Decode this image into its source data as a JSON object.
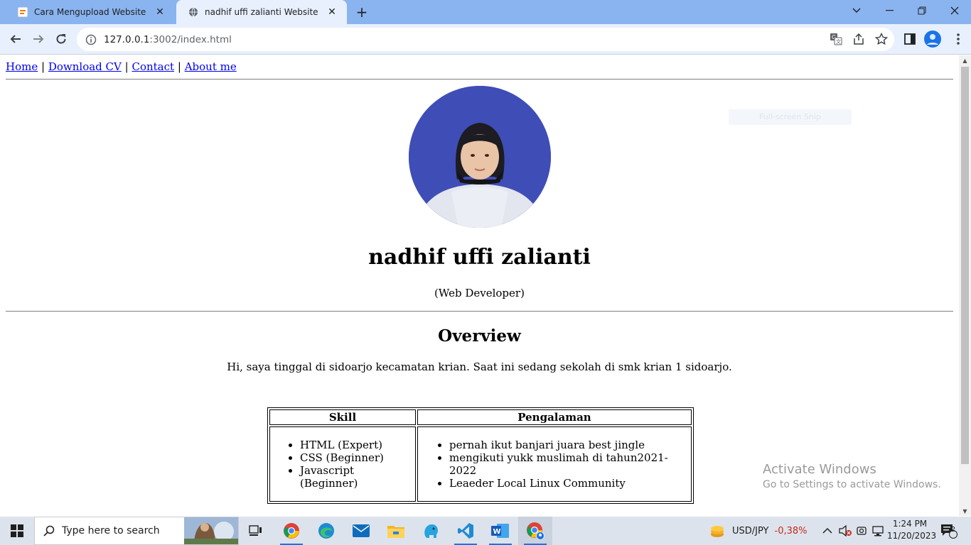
{
  "browser": {
    "tabs": [
      {
        "title": "Cara Mengupload Website ke GitHub",
        "active": false
      },
      {
        "title": "nadhif uffi zalianti Website",
        "active": true
      }
    ],
    "url": {
      "host": "127.0.0.1",
      "path": ":3002/index.html"
    },
    "icons": [
      "back-arrow-icon",
      "forward-arrow-icon",
      "reload-icon",
      "site-info-icon",
      "translate-icon",
      "share-icon",
      "bookmark-star-icon",
      "side-panel-icon",
      "profile-icon",
      "more-menu-icon"
    ]
  },
  "page": {
    "nav": [
      {
        "label": "Home"
      },
      {
        "label": "Download CV"
      },
      {
        "label": "Contact"
      },
      {
        "label": "About me"
      }
    ],
    "nav_separator": "|",
    "name": "nadhif uffi zalianti",
    "role": "(Web Developer)",
    "overview_heading": "Overview",
    "overview_text": "Hi, saya tinggal di sidoarjo kecamatan krian. Saat ini sedang sekolah di smk krian 1 sidoarjo.",
    "table": {
      "headers": [
        "Skill",
        "Pengalaman"
      ],
      "skills": [
        "HTML (Expert)",
        "CSS (Beginner)",
        "Javascript (Beginner)"
      ],
      "experience": [
        "pernah ikut banjari juara best jingle",
        "mengikuti yukk muslimah di tahun2021-2022",
        "Leaeder Local Linux Community"
      ]
    },
    "snip_overlay": "Full-screen Snip",
    "activate": {
      "line1": "Activate Windows",
      "line2": "Go to Settings to activate Windows."
    }
  },
  "taskbar": {
    "search_placeholder": "Type here to search",
    "ticker": {
      "label": "USD/JPY",
      "change": "-0,38%",
      "change_color": "#c42b1c"
    },
    "time": "1:24 PM",
    "date": "11/20/2023",
    "notifications": "2"
  },
  "colors": {
    "tab_strip": "#8ab4f0",
    "toolbar": "#e8f0fd",
    "link": "#0000ee",
    "avatar_bg": "#3f4db6"
  }
}
